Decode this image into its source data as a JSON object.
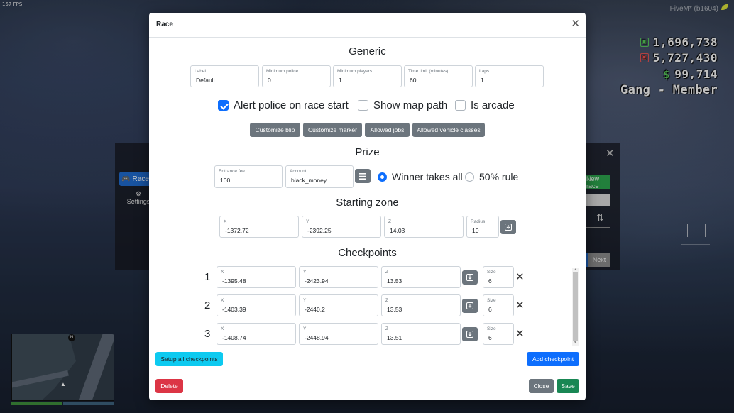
{
  "fps": "157 FPS",
  "build": "FiveM* (b1604)",
  "hud": {
    "bank": "1,696,738",
    "dirty": "5,727,430",
    "cash_symbol": "$",
    "cash": "99,714",
    "job": "Gang - Member"
  },
  "background_panel": {
    "nav_races": "Races",
    "nav_settings": "Settings",
    "new_race": "New race",
    "next": "Next"
  },
  "modal": {
    "title": "Race",
    "generic": {
      "heading": "Generic",
      "fields": [
        {
          "label": "Label",
          "value": "Default"
        },
        {
          "label": "Minimum police",
          "value": "0"
        },
        {
          "label": "Minimum players",
          "value": "1"
        },
        {
          "label": "Time limit (minutes)",
          "value": "60"
        },
        {
          "label": "Laps",
          "value": "1"
        }
      ],
      "checks": [
        {
          "label": "Alert police on race start",
          "checked": true
        },
        {
          "label": "Show map path",
          "checked": false
        },
        {
          "label": "Is arcade",
          "checked": false
        }
      ],
      "buttons": [
        "Customize blip",
        "Customize marker",
        "Allowed jobs",
        "Allowed vehicle classes"
      ]
    },
    "prize": {
      "heading": "Prize",
      "entrance_fee_label": "Entrance fee",
      "entrance_fee": "100",
      "account_label": "Account",
      "account": "black_money",
      "options": [
        {
          "label": "Winner takes all",
          "selected": true
        },
        {
          "label": "50% rule",
          "selected": false
        }
      ]
    },
    "starting_zone": {
      "heading": "Starting zone",
      "x_label": "X",
      "x": "-1372.72",
      "y_label": "Y",
      "y": "-2392.25",
      "z_label": "Z",
      "z": "14.03",
      "radius_label": "Radius",
      "radius": "10"
    },
    "checkpoints": {
      "heading": "Checkpoints",
      "items": [
        {
          "num": "1",
          "x": "-1395.48",
          "y": "-2423.94",
          "z": "13.53",
          "size": "6"
        },
        {
          "num": "2",
          "x": "-1403.39",
          "y": "-2440.2",
          "z": "13.53",
          "size": "6"
        },
        {
          "num": "3",
          "x": "-1408.74",
          "y": "-2448.94",
          "z": "13.51",
          "size": "6"
        }
      ],
      "x_label": "X",
      "y_label": "Y",
      "z_label": "Z",
      "size_label": "Size",
      "setup_all": "Setup all checkpoints",
      "add": "Add checkpoint"
    },
    "footer": {
      "delete": "Delete",
      "close": "Close",
      "save": "Save"
    }
  },
  "colors": {
    "primary": "#0d6efd",
    "secondary": "#6c757d",
    "danger": "#dc3545",
    "success": "#198754",
    "info": "#0dcaf0"
  }
}
